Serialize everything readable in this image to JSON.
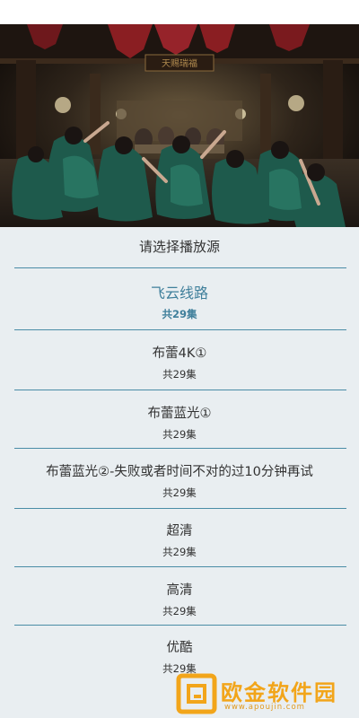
{
  "panel": {
    "title": "请选择播放源"
  },
  "sources": [
    {
      "name": "飞云线路",
      "count": "共29集",
      "selected": true
    },
    {
      "name": "布蕾4K①",
      "count": "共29集",
      "selected": false
    },
    {
      "name": "布蕾蓝光①",
      "count": "共29集",
      "selected": false
    },
    {
      "name": "布蕾蓝光②-失败或者时间不对的过10分钟再试",
      "count": "共29集",
      "selected": false
    },
    {
      "name": "超清",
      "count": "共29集",
      "selected": false
    },
    {
      "name": "高清",
      "count": "共29集",
      "selected": false
    },
    {
      "name": "优酷",
      "count": "共29集",
      "selected": false
    }
  ],
  "video": {
    "sign_text": "天赐瑞福"
  },
  "watermark": {
    "text": "欧金软件园",
    "url": "www.apoujin.com"
  },
  "colors": {
    "accent": "#3f7f9b",
    "divider": "#4a8ca6",
    "panel_bg": "#e9eef1",
    "watermark": "#f2a51a"
  }
}
